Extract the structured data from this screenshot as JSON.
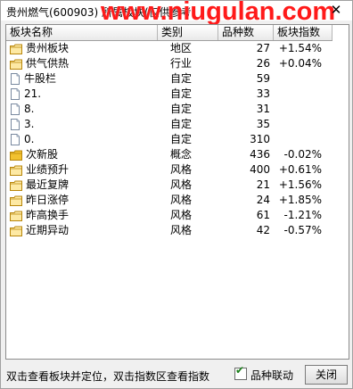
{
  "window": {
    "title": "贵州燃气(600903)  所属板块(仅供参考",
    "watermark": "www.niugulan.com"
  },
  "table": {
    "headers": [
      "板块名称",
      "类别",
      "品种数",
      "板块指数"
    ],
    "rows": [
      {
        "icon": "folder",
        "name": "贵州板块",
        "type": "地区",
        "count": "27",
        "index": "+1.54%"
      },
      {
        "icon": "folder",
        "name": "供气供热",
        "type": "行业",
        "count": "26",
        "index": "+0.04%"
      },
      {
        "icon": "doc",
        "name": "牛股栏",
        "type": "自定",
        "count": "59",
        "index": ""
      },
      {
        "icon": "doc",
        "name": "21.",
        "type": "自定",
        "count": "33",
        "index": ""
      },
      {
        "icon": "doc",
        "name": "8.",
        "type": "自定",
        "count": "31",
        "index": ""
      },
      {
        "icon": "doc",
        "name": "3.",
        "type": "自定",
        "count": "35",
        "index": ""
      },
      {
        "icon": "doc",
        "name": "0.",
        "type": "自定",
        "count": "310",
        "index": ""
      },
      {
        "icon": "folder-filled",
        "name": "次新股",
        "type": "概念",
        "count": "436",
        "index": "-0.02%"
      },
      {
        "icon": "folder",
        "name": "业绩预升",
        "type": "风格",
        "count": "400",
        "index": "+0.61%"
      },
      {
        "icon": "folder",
        "name": "最近复牌",
        "type": "风格",
        "count": "21",
        "index": "+1.56%"
      },
      {
        "icon": "folder",
        "name": "昨日涨停",
        "type": "风格",
        "count": "24",
        "index": "+1.85%"
      },
      {
        "icon": "folder",
        "name": "昨高换手",
        "type": "风格",
        "count": "61",
        "index": "-1.21%"
      },
      {
        "icon": "folder",
        "name": "近期异动",
        "type": "风格",
        "count": "42",
        "index": "-0.57%"
      }
    ]
  },
  "footer": {
    "hint": "双击查看板块并定位，双击指数区查看指数",
    "checkbox_label": "品种联动",
    "checkbox_checked": true,
    "close_label": "关闭"
  }
}
